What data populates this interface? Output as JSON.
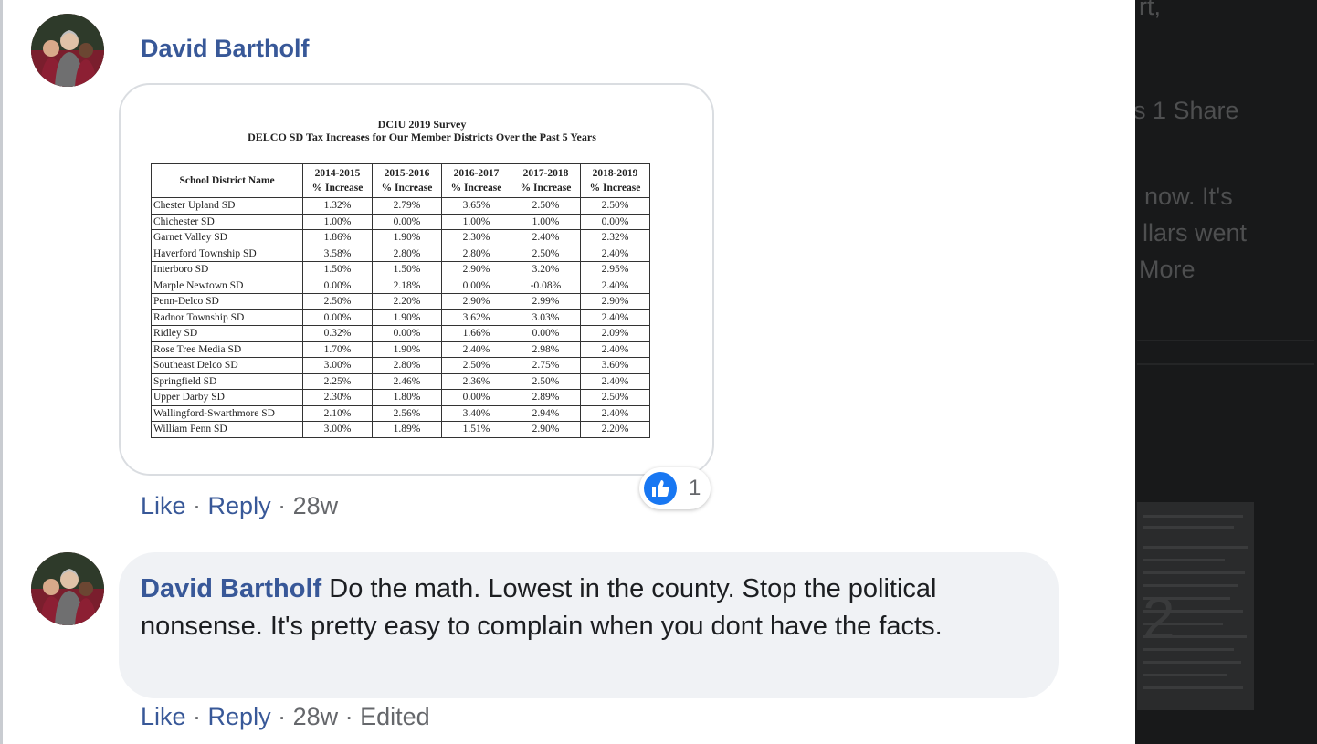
{
  "comments": [
    {
      "author": "David Bartholf",
      "reply": "Reply",
      "like": "Like",
      "time": "28w",
      "reaction_count": "1"
    },
    {
      "author": "David Bartholf",
      "text": "Do the math. Lowest in the county. Stop the political nonsense. It's pretty easy to complain when you dont have the facts.",
      "like": "Like",
      "reply": "Reply",
      "time": "28w",
      "edited": "Edited"
    }
  ],
  "attachment": {
    "title": "DCIU 2019 Survey",
    "subtitle": "DELCO SD Tax Increases for Our Member Districts Over the Past 5 Years",
    "header_name": "School District Name",
    "years": [
      "2014-2015",
      "2015-2016",
      "2016-2017",
      "2017-2018",
      "2018-2019"
    ],
    "pct_label": "% Increase",
    "rows": [
      [
        "Chester Upland SD",
        "1.32%",
        "2.79%",
        "3.65%",
        "2.50%",
        "2.50%"
      ],
      [
        "Chichester SD",
        "1.00%",
        "0.00%",
        "1.00%",
        "1.00%",
        "0.00%"
      ],
      [
        "Garnet Valley SD",
        "1.86%",
        "1.90%",
        "2.30%",
        "2.40%",
        "2.32%"
      ],
      [
        "Haverford Township SD",
        "3.58%",
        "2.80%",
        "2.80%",
        "2.50%",
        "2.40%"
      ],
      [
        "Interboro SD",
        "1.50%",
        "1.50%",
        "2.90%",
        "3.20%",
        "2.95%"
      ],
      [
        "Marple Newtown SD",
        "0.00%",
        "2.18%",
        "0.00%",
        "-0.08%",
        "2.40%"
      ],
      [
        "Penn-Delco SD",
        "2.50%",
        "2.20%",
        "2.90%",
        "2.99%",
        "2.90%"
      ],
      [
        "Radnor Township SD",
        "0.00%",
        "1.90%",
        "3.62%",
        "3.03%",
        "2.40%"
      ],
      [
        "Ridley SD",
        "0.32%",
        "0.00%",
        "1.66%",
        "0.00%",
        "2.09%"
      ],
      [
        "Rose Tree Media SD",
        "1.70%",
        "1.90%",
        "2.40%",
        "2.98%",
        "2.40%"
      ],
      [
        "Southeast Delco SD",
        "3.00%",
        "2.80%",
        "2.50%",
        "2.75%",
        "3.60%"
      ],
      [
        "Springfield SD",
        "2.25%",
        "2.46%",
        "2.36%",
        "2.50%",
        "2.40%"
      ],
      [
        "Upper Darby SD",
        "2.30%",
        "1.80%",
        "0.00%",
        "2.89%",
        "2.50%"
      ],
      [
        "Wallingford-Swarthmore SD",
        "2.10%",
        "2.56%",
        "3.40%",
        "2.94%",
        "2.40%"
      ],
      [
        "William Penn SD",
        "3.00%",
        "1.89%",
        "1.51%",
        "2.90%",
        "2.20%"
      ]
    ]
  },
  "right_panel": {
    "frag1": "rt,",
    "frag2": "s  1 Share",
    "frag3": "now. It's",
    "frag4": "llars went",
    "frag5": "More",
    "frag6": "2"
  },
  "colors": {
    "link": "#385898",
    "meta": "#65676b",
    "bubble": "#f0f2f5",
    "like_blue": "#1877f2"
  }
}
